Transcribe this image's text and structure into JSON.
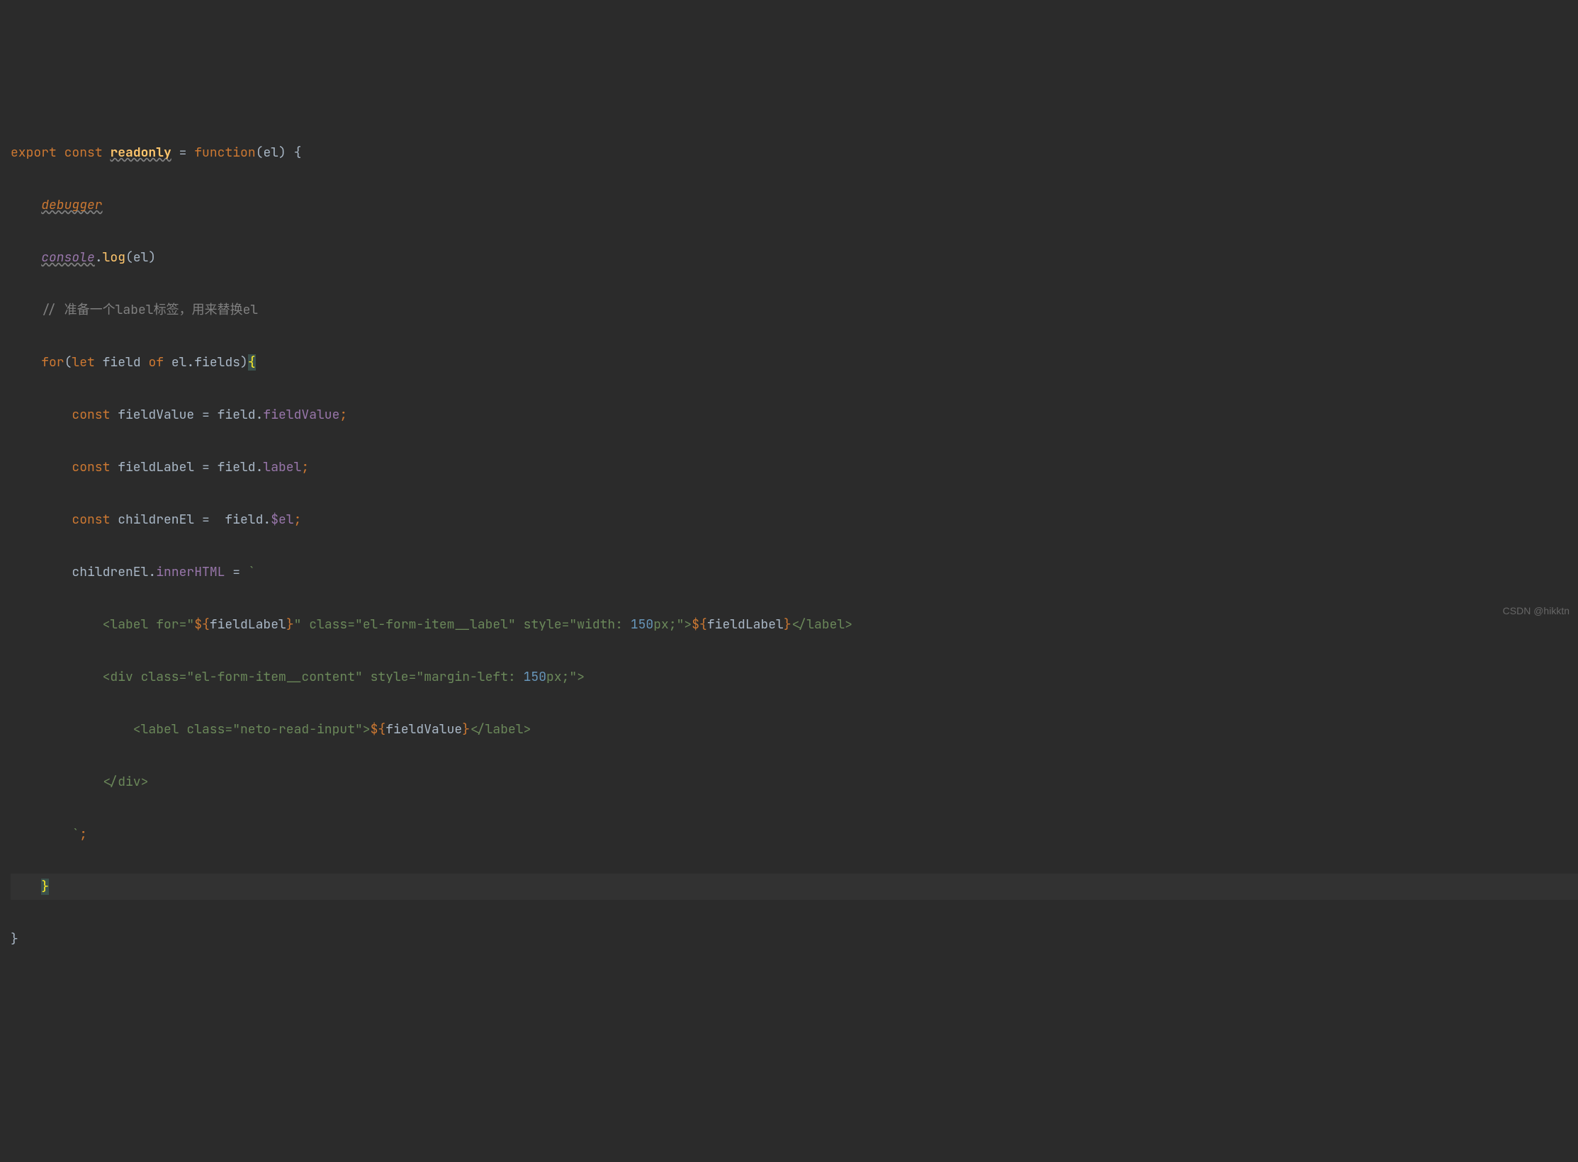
{
  "watermark": "CSDN @hikktn",
  "code": {
    "l1": {
      "export": "export",
      "const": "const",
      "readonly": "readonly",
      "eq": " = ",
      "function": "function",
      "open": "(el) {"
    },
    "l2": {
      "debugger": "debugger"
    },
    "l3": {
      "console": "console",
      "dot": ".",
      "log": "log",
      "args": "(el)"
    },
    "l4": {
      "comment": "// 准备一个label标签，用来替换el"
    },
    "l5": {
      "for": "for",
      "open": "(",
      "let": "let",
      "field": " field ",
      "of": "of",
      "expr": " el.fields)",
      "brace": "{"
    },
    "l6": {
      "const": "const",
      "name": " fieldValue = field.",
      "prop": "fieldValue",
      "semi": ";"
    },
    "l7": {
      "const": "const",
      "name": " fieldLabel = field.",
      "prop": "label",
      "semi": ";"
    },
    "l8": {
      "const": "const",
      "name": " childrenEl =  field.",
      "prop": "$el",
      "semi": ";"
    },
    "l9": {
      "lhs": "childrenEl.",
      "prop": "innerHTML",
      "eq": " = ",
      "btick": "`"
    },
    "l10": {
      "s1": "        <label for=\"",
      "v1": "${",
      "e1": "fieldLabel",
      "v1c": "}",
      "s2": "\" class=\"el-form-item__label\" style=\"width: ",
      "num": "150",
      "s3": "px;\">",
      "v2": "${",
      "e2": "fieldLabel",
      "v2c": "}",
      "s4": "</label>"
    },
    "l11": {
      "s1": "        <div class=\"el-form-item__content\" style=\"margin-left: ",
      "num": "150",
      "s2": "px;\">"
    },
    "l12": {
      "s1": "            <label class=\"neto-read-input\">",
      "v1": "${",
      "e1": "fieldValue",
      "v1c": "}",
      "s2": "</label>"
    },
    "l13": {
      "s1": "        </div>"
    },
    "l14": {
      "btick": "`",
      "semi": ";"
    },
    "l15": {
      "brace": "}"
    },
    "l16": {
      "brace": "}"
    }
  }
}
